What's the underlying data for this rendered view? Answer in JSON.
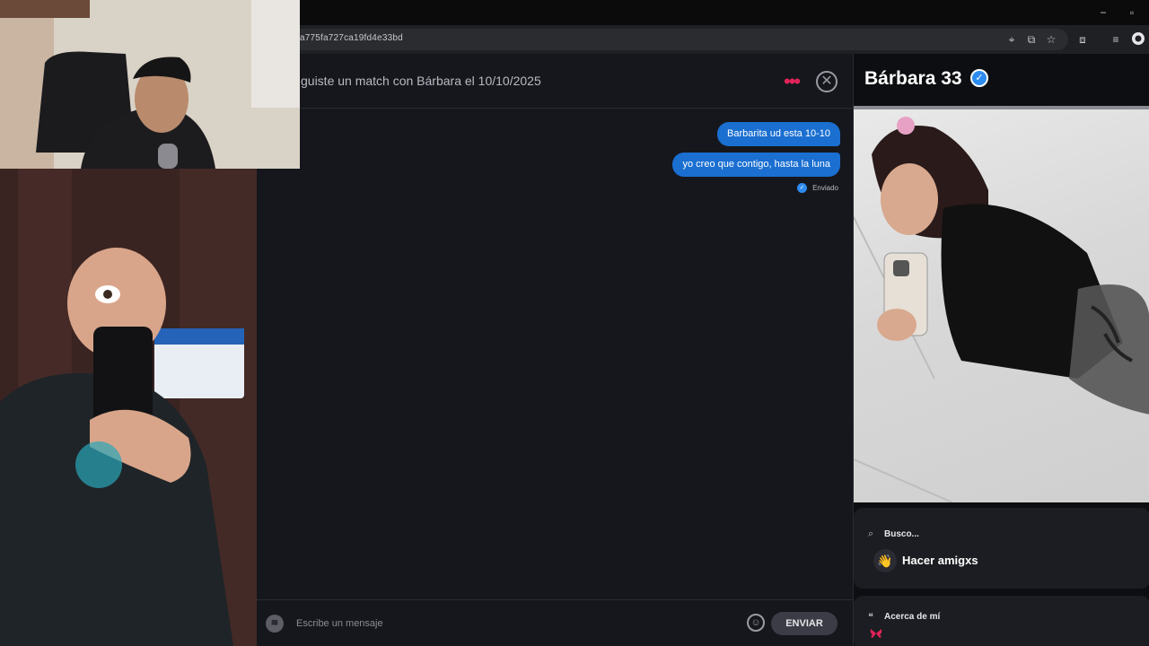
{
  "browser": {
    "url": "a775fa727ca19fd4e33bd",
    "window_controls": [
      "−",
      "▫"
    ]
  },
  "chat": {
    "match_text": "guiste un match con Bárbara el 10/10/2025",
    "messages": [
      {
        "text": "Barbarita ud esta 10-10",
        "from": "me"
      },
      {
        "text": "yo creo que contigo, hasta la luna",
        "from": "me"
      }
    ],
    "status": "Enviado",
    "input_placeholder": "Escribe un mensaje",
    "send_label": "ENVIAR"
  },
  "profile": {
    "name_age": "Bárbara 33",
    "busco_label": "Busco...",
    "busco_value": "Hacer amigxs",
    "about_label": "Acerca de mí"
  },
  "colors": {
    "accent_blue": "#1a6fd1",
    "dots_pink": "#e2245a",
    "background": "#16171d"
  }
}
